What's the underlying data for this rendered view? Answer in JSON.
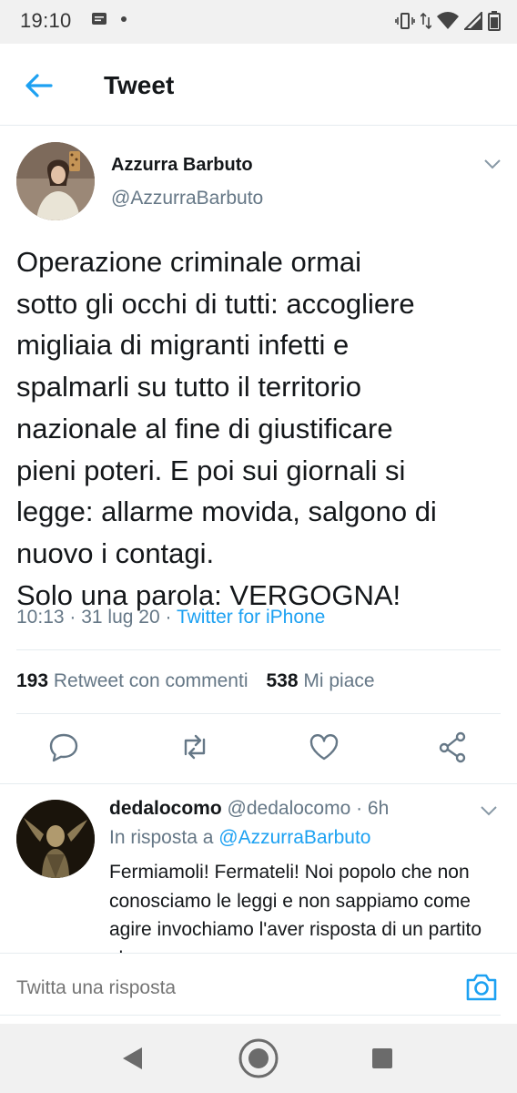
{
  "status_bar": {
    "time": "19:10",
    "icons": [
      "message-icon",
      "dot-icon",
      "vibrate-icon",
      "data-arrows-icon",
      "wifi-icon",
      "signal-icon",
      "battery-icon"
    ]
  },
  "app_bar": {
    "title": "Tweet",
    "back_icon": "back-arrow-icon"
  },
  "tweet": {
    "author_name": "Azzurra Barbuto",
    "author_handle": "@AzzurraBarbuto",
    "text": "Operazione criminale ormai\nsotto gli occhi di tutti: accogliere\nmigliaia di migranti infetti e\nspalmarli su tutto il territorio\nnazionale al fine di giustificare\npieni poteri. E poi sui giornali si\nlegge: allarme movida, salgono di\nnuovo i contagi.\nSolo una parola: VERGOGNA!",
    "time": "10:13",
    "date": "31 lug 20",
    "separator": " · ",
    "source": "Twitter for iPhone",
    "retweets_count": "193",
    "retweets_label": "Retweet con commenti",
    "likes_count": "538",
    "likes_label": "Mi piace"
  },
  "actions": [
    "reply-icon",
    "retweet-icon",
    "like-icon",
    "share-icon"
  ],
  "reply": {
    "name": "dedalocomo",
    "handle": "@dedalocomo",
    "time": "· 6h",
    "in_reply_label": "In risposta a",
    "in_reply_mention": "@AzzurraBarbuto",
    "text": "Fermiamoli! Fermateli! Noi popolo che non conosciamo le leggi e non sappiamo come agire invochiamo l'aver risposta di un partito che..."
  },
  "composer": {
    "placeholder": "Twitta una risposta"
  },
  "colors": {
    "accent": "#1da1f2",
    "secondary_text": "#657786",
    "primary_text": "#14171a"
  }
}
